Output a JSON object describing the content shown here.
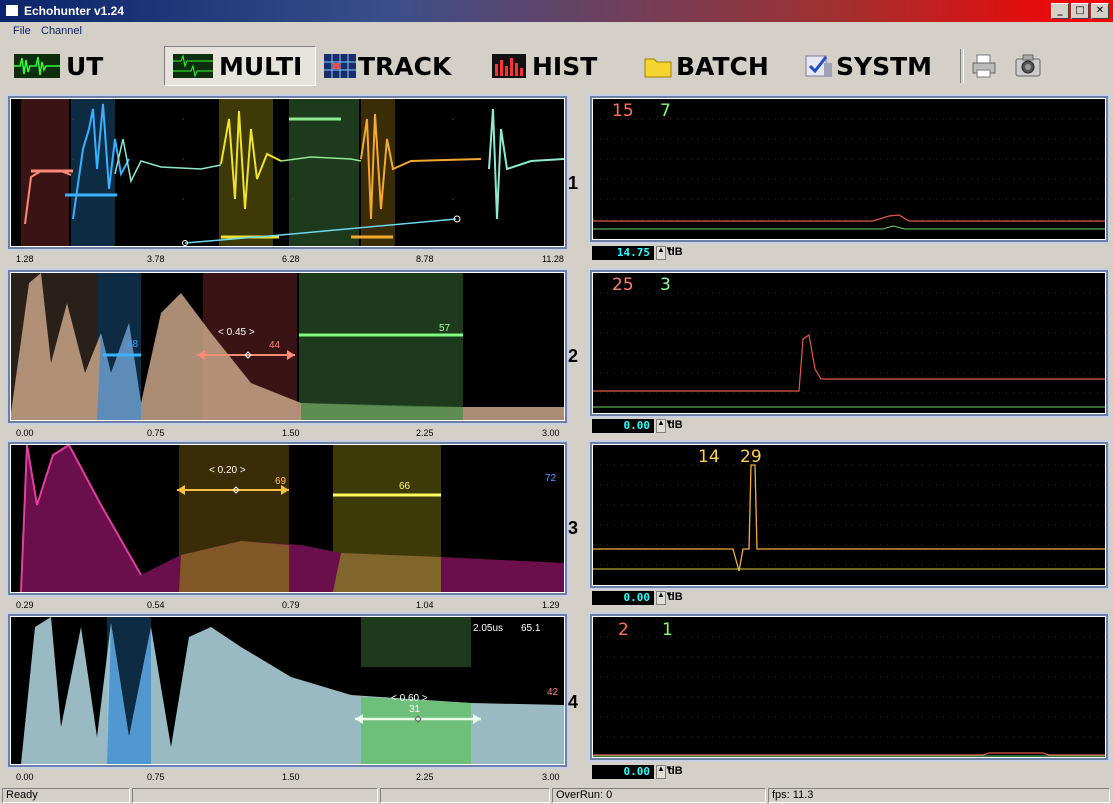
{
  "window": {
    "title": "Echohunter v1.24"
  },
  "menu": [
    {
      "label": "File"
    },
    {
      "label": "Channel"
    }
  ],
  "toolbar": {
    "buttons": [
      {
        "label": "UT",
        "icon": "waveform-icon",
        "active": false
      },
      {
        "label": "MULTI",
        "icon": "multi-waveform-icon",
        "active": true
      },
      {
        "label": "TRACK",
        "icon": "track-grid-icon",
        "active": false
      },
      {
        "label": "HIST",
        "icon": "histogram-icon",
        "active": false
      },
      {
        "label": "BATCH",
        "icon": "folder-icon",
        "active": false
      },
      {
        "label": "SYSTM",
        "icon": "system-check-icon",
        "active": false
      }
    ],
    "print_icon": "printer-icon",
    "camera_icon": "camera-icon"
  },
  "channels": [
    {
      "number": "1",
      "ticks": [
        "1.28",
        "3.78",
        "6.28",
        "8.78",
        "11.28"
      ],
      "gain": "14.75",
      "db_label": "dB",
      "readouts": [
        {
          "value": "15",
          "color": "#ff7060"
        },
        {
          "value": "7",
          "color": "#80ff80"
        }
      ],
      "overlay": []
    },
    {
      "number": "2",
      "ticks": [
        "0.00",
        "0.75",
        "1.50",
        "2.25",
        "3.00"
      ],
      "gain": "0.00",
      "db_label": "dB",
      "readouts": [
        {
          "value": "25",
          "color": "#ff8070"
        },
        {
          "value": "3",
          "color": "#90ff90"
        }
      ],
      "overlay": [
        {
          "text": "< 0.45 >",
          "color": "#ffffff"
        },
        {
          "text": "44",
          "color": "#ff8080"
        },
        {
          "text": "57",
          "color": "#a0ffa0"
        },
        {
          "text": "48",
          "color": "#4aa0ff"
        }
      ]
    },
    {
      "number": "3",
      "ticks": [
        "0.29",
        "0.54",
        "0.79",
        "1.04",
        "1.29"
      ],
      "gain": "0.00",
      "db_label": "dB",
      "readouts": [
        {
          "value": "14",
          "color": "#ffd050"
        },
        {
          "value": "29",
          "color": "#ffd050"
        }
      ],
      "overlay": [
        {
          "text": "< 0.20 >",
          "color": "#ffffff"
        },
        {
          "text": "69",
          "color": "#ffc040"
        },
        {
          "text": "66",
          "color": "#ffff60"
        },
        {
          "text": "72",
          "color": "#4aa0ff"
        }
      ]
    },
    {
      "number": "4",
      "ticks": [
        "0.00",
        "0.75",
        "1.50",
        "2.25",
        "3.00"
      ],
      "gain": "0.00",
      "db_label": "dB",
      "readouts": [
        {
          "value": "2",
          "color": "#ff7060"
        },
        {
          "value": "1",
          "color": "#80ff80"
        }
      ],
      "overlay": [
        {
          "text": "2.05us",
          "color": "#ffffff"
        },
        {
          "text": "65.1",
          "color": "#ffffff"
        },
        {
          "text": "< 0.60 >",
          "color": "#ffffff"
        },
        {
          "text": "31",
          "color": "#ffffff"
        },
        {
          "text": "42",
          "color": "#ff8080"
        }
      ]
    }
  ],
  "status": {
    "ready": "Ready",
    "overrun": "OverRun: 0",
    "fps": "fps: 11.3"
  }
}
